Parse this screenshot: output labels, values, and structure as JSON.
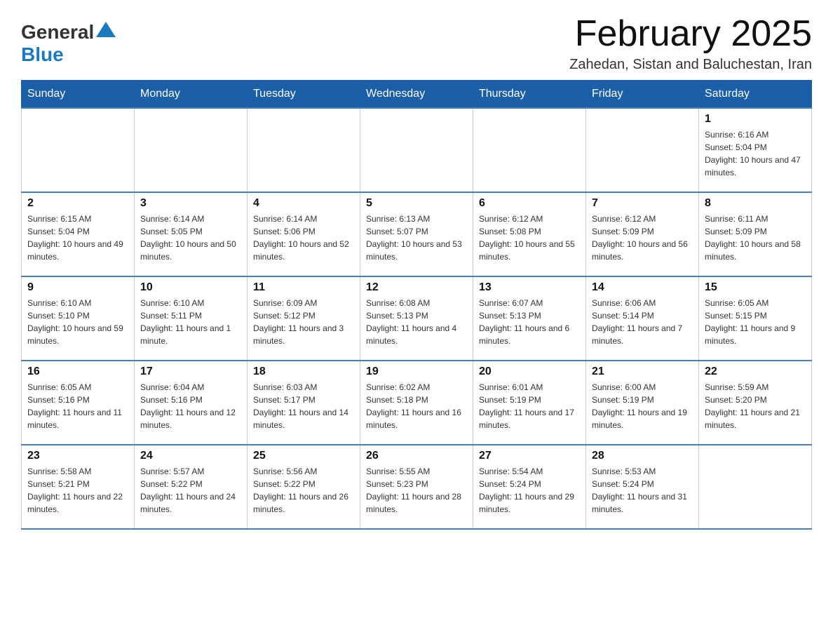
{
  "header": {
    "logo_general": "General",
    "logo_blue": "Blue",
    "title": "February 2025",
    "subtitle": "Zahedan, Sistan and Baluchestan, Iran"
  },
  "days_of_week": [
    "Sunday",
    "Monday",
    "Tuesday",
    "Wednesday",
    "Thursday",
    "Friday",
    "Saturday"
  ],
  "weeks": [
    [
      {
        "day": "",
        "info": ""
      },
      {
        "day": "",
        "info": ""
      },
      {
        "day": "",
        "info": ""
      },
      {
        "day": "",
        "info": ""
      },
      {
        "day": "",
        "info": ""
      },
      {
        "day": "",
        "info": ""
      },
      {
        "day": "1",
        "info": "Sunrise: 6:16 AM\nSunset: 5:04 PM\nDaylight: 10 hours and 47 minutes."
      }
    ],
    [
      {
        "day": "2",
        "info": "Sunrise: 6:15 AM\nSunset: 5:04 PM\nDaylight: 10 hours and 49 minutes."
      },
      {
        "day": "3",
        "info": "Sunrise: 6:14 AM\nSunset: 5:05 PM\nDaylight: 10 hours and 50 minutes."
      },
      {
        "day": "4",
        "info": "Sunrise: 6:14 AM\nSunset: 5:06 PM\nDaylight: 10 hours and 52 minutes."
      },
      {
        "day": "5",
        "info": "Sunrise: 6:13 AM\nSunset: 5:07 PM\nDaylight: 10 hours and 53 minutes."
      },
      {
        "day": "6",
        "info": "Sunrise: 6:12 AM\nSunset: 5:08 PM\nDaylight: 10 hours and 55 minutes."
      },
      {
        "day": "7",
        "info": "Sunrise: 6:12 AM\nSunset: 5:09 PM\nDaylight: 10 hours and 56 minutes."
      },
      {
        "day": "8",
        "info": "Sunrise: 6:11 AM\nSunset: 5:09 PM\nDaylight: 10 hours and 58 minutes."
      }
    ],
    [
      {
        "day": "9",
        "info": "Sunrise: 6:10 AM\nSunset: 5:10 PM\nDaylight: 10 hours and 59 minutes."
      },
      {
        "day": "10",
        "info": "Sunrise: 6:10 AM\nSunset: 5:11 PM\nDaylight: 11 hours and 1 minute."
      },
      {
        "day": "11",
        "info": "Sunrise: 6:09 AM\nSunset: 5:12 PM\nDaylight: 11 hours and 3 minutes."
      },
      {
        "day": "12",
        "info": "Sunrise: 6:08 AM\nSunset: 5:13 PM\nDaylight: 11 hours and 4 minutes."
      },
      {
        "day": "13",
        "info": "Sunrise: 6:07 AM\nSunset: 5:13 PM\nDaylight: 11 hours and 6 minutes."
      },
      {
        "day": "14",
        "info": "Sunrise: 6:06 AM\nSunset: 5:14 PM\nDaylight: 11 hours and 7 minutes."
      },
      {
        "day": "15",
        "info": "Sunrise: 6:05 AM\nSunset: 5:15 PM\nDaylight: 11 hours and 9 minutes."
      }
    ],
    [
      {
        "day": "16",
        "info": "Sunrise: 6:05 AM\nSunset: 5:16 PM\nDaylight: 11 hours and 11 minutes."
      },
      {
        "day": "17",
        "info": "Sunrise: 6:04 AM\nSunset: 5:16 PM\nDaylight: 11 hours and 12 minutes."
      },
      {
        "day": "18",
        "info": "Sunrise: 6:03 AM\nSunset: 5:17 PM\nDaylight: 11 hours and 14 minutes."
      },
      {
        "day": "19",
        "info": "Sunrise: 6:02 AM\nSunset: 5:18 PM\nDaylight: 11 hours and 16 minutes."
      },
      {
        "day": "20",
        "info": "Sunrise: 6:01 AM\nSunset: 5:19 PM\nDaylight: 11 hours and 17 minutes."
      },
      {
        "day": "21",
        "info": "Sunrise: 6:00 AM\nSunset: 5:19 PM\nDaylight: 11 hours and 19 minutes."
      },
      {
        "day": "22",
        "info": "Sunrise: 5:59 AM\nSunset: 5:20 PM\nDaylight: 11 hours and 21 minutes."
      }
    ],
    [
      {
        "day": "23",
        "info": "Sunrise: 5:58 AM\nSunset: 5:21 PM\nDaylight: 11 hours and 22 minutes."
      },
      {
        "day": "24",
        "info": "Sunrise: 5:57 AM\nSunset: 5:22 PM\nDaylight: 11 hours and 24 minutes."
      },
      {
        "day": "25",
        "info": "Sunrise: 5:56 AM\nSunset: 5:22 PM\nDaylight: 11 hours and 26 minutes."
      },
      {
        "day": "26",
        "info": "Sunrise: 5:55 AM\nSunset: 5:23 PM\nDaylight: 11 hours and 28 minutes."
      },
      {
        "day": "27",
        "info": "Sunrise: 5:54 AM\nSunset: 5:24 PM\nDaylight: 11 hours and 29 minutes."
      },
      {
        "day": "28",
        "info": "Sunrise: 5:53 AM\nSunset: 5:24 PM\nDaylight: 11 hours and 31 minutes."
      },
      {
        "day": "",
        "info": ""
      }
    ]
  ]
}
